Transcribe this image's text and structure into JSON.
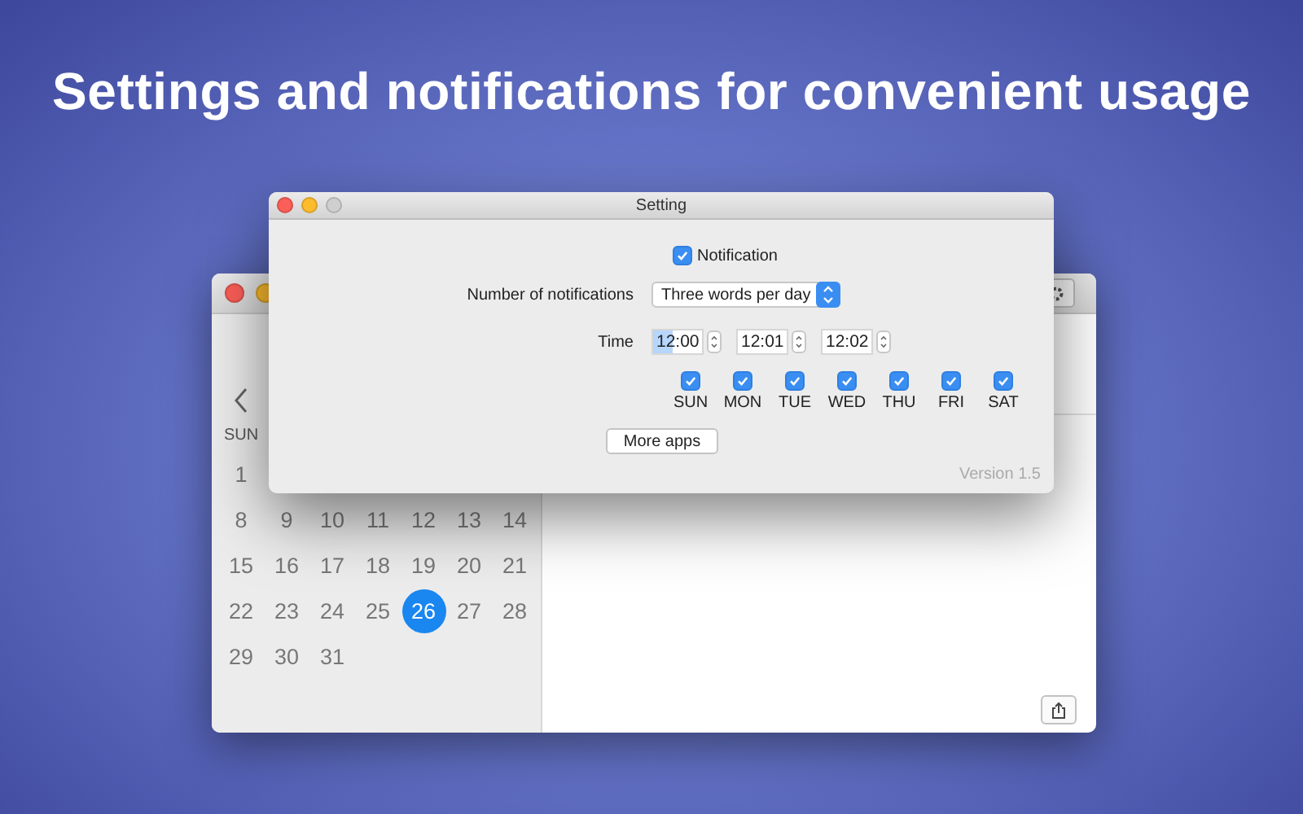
{
  "headline": "Settings and notifications for convenient usage",
  "back_window": {
    "sidebar": {
      "day_header": "SUN",
      "weeks": [
        [
          {
            "day": "1",
            "selected": false
          }
        ],
        [
          {
            "day": "8",
            "selected": false
          },
          {
            "day": "9",
            "selected": false
          },
          {
            "day": "10",
            "selected": false
          },
          {
            "day": "11",
            "selected": false
          },
          {
            "day": "12",
            "selected": false
          },
          {
            "day": "13",
            "selected": false
          },
          {
            "day": "14",
            "selected": false
          }
        ],
        [
          {
            "day": "15",
            "selected": false
          },
          {
            "day": "16",
            "selected": false
          },
          {
            "day": "17",
            "selected": false
          },
          {
            "day": "18",
            "selected": false
          },
          {
            "day": "19",
            "selected": false
          },
          {
            "day": "20",
            "selected": false
          },
          {
            "day": "21",
            "selected": false
          }
        ],
        [
          {
            "day": "22",
            "selected": false
          },
          {
            "day": "23",
            "selected": false
          },
          {
            "day": "24",
            "selected": false
          },
          {
            "day": "25",
            "selected": false
          },
          {
            "day": "26",
            "selected": true
          },
          {
            "day": "27",
            "selected": false
          },
          {
            "day": "28",
            "selected": false
          }
        ],
        [
          {
            "day": "29",
            "selected": false
          },
          {
            "day": "30",
            "selected": false
          },
          {
            "day": "31",
            "selected": false
          }
        ]
      ]
    }
  },
  "dialog": {
    "title": "Setting",
    "notification": {
      "label": "Notification",
      "checked": true
    },
    "count": {
      "label": "Number of notifications",
      "value": "Three words per day"
    },
    "time": {
      "label": "Time",
      "fields": [
        {
          "value": "12:00",
          "focused": true
        },
        {
          "value": "12:01",
          "focused": false
        },
        {
          "value": "12:02",
          "focused": false
        }
      ]
    },
    "days": [
      {
        "label": "SUN",
        "checked": true
      },
      {
        "label": "MON",
        "checked": true
      },
      {
        "label": "TUE",
        "checked": true
      },
      {
        "label": "WED",
        "checked": true
      },
      {
        "label": "THU",
        "checked": true
      },
      {
        "label": "FRI",
        "checked": true
      },
      {
        "label": "SAT",
        "checked": true
      }
    ],
    "button": "More apps",
    "version": "Version 1.5"
  }
}
